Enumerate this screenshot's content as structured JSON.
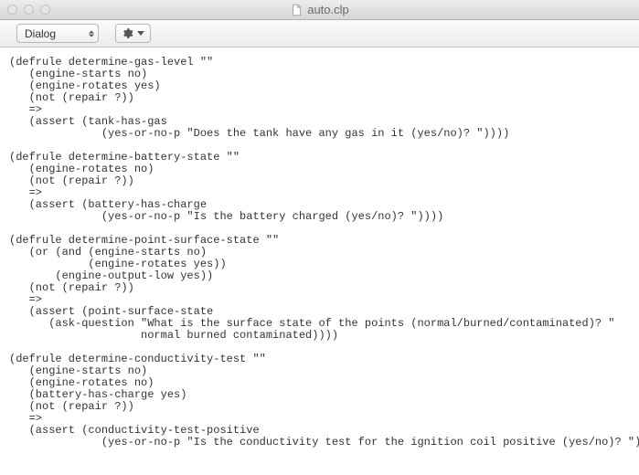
{
  "window": {
    "title": "auto.clp"
  },
  "toolbar": {
    "language_select": "Dialog"
  },
  "editor": {
    "content": "(defrule determine-gas-level \"\"\n   (engine-starts no)\n   (engine-rotates yes)\n   (not (repair ?))\n   =>\n   (assert (tank-has-gas\n              (yes-or-no-p \"Does the tank have any gas in it (yes/no)? \"))))\n\n(defrule determine-battery-state \"\"\n   (engine-rotates no)\n   (not (repair ?))\n   =>\n   (assert (battery-has-charge\n              (yes-or-no-p \"Is the battery charged (yes/no)? \"))))\n\n(defrule determine-point-surface-state \"\"\n   (or (and (engine-starts no)\n            (engine-rotates yes))\n       (engine-output-low yes))\n   (not (repair ?))\n   =>\n   (assert (point-surface-state\n      (ask-question \"What is the surface state of the points (normal/burned/contaminated)? \"\n                    normal burned contaminated))))\n\n(defrule determine-conductivity-test \"\"\n   (engine-starts no)\n   (engine-rotates no)\n   (battery-has-charge yes)\n   (not (repair ?))\n   =>\n   (assert (conductivity-test-positive\n              (yes-or-no-p \"Is the conductivity test for the ignition coil positive (yes/no)? \"))))"
  }
}
